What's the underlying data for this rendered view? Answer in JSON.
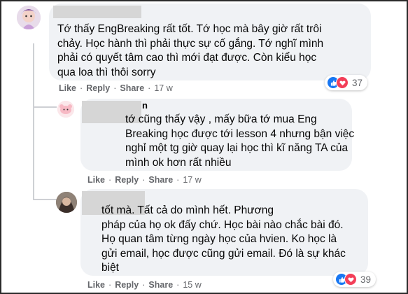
{
  "comments": [
    {
      "text": "Tớ thấy EngBreaking rất tốt. Tớ học mà bây giờ rất trôi\nchảy. Học hành thì phải thực sự cố gắng. Tớ nghĩ mình\nphải có quyết tâm cao thì mới đạt được. Còn kiểu học\nqua loa thì thôi sorry",
      "like_label": "Like",
      "reply_label": "Reply",
      "share_label": "Share",
      "time": "17 w",
      "reaction_count": "37",
      "reactions": [
        "like-icon",
        "love-icon"
      ]
    },
    {
      "name_fragment": "n",
      "text": "     tớ cũng thấy vậy , mấy bữa tớ mua Eng\nBreaking học được tới lesson 4 nhưng bận việc\nnghỉ một tg giờ quay lại học thì kĩ năng TA của\nmình ok hơn rất nhiều",
      "like_label": "Like",
      "reply_label": "Reply",
      "share_label": "Share",
      "time": "17 w"
    },
    {
      "text": "          tốt mà. Tất cả do mình hết. Phương\npháp của họ ok đấy chứ. Học bài nào chắc bài đó.\nHọ quan tâm từng ngày học của hvien. Ko học là\ngửi email, học được cũng gửi email. Đó là sự khác\nbiệt",
      "like_label": "Like",
      "reply_label": "Reply",
      "share_label": "Share",
      "time": "15 w",
      "reaction_count": "39",
      "reactions": [
        "like-icon",
        "love-icon"
      ]
    }
  ],
  "colors": {
    "bubble": "#f0f2f5",
    "meta": "#65676b",
    "like": "#1877f2",
    "love": "#f33e58",
    "redaction": "#d6d6d6"
  }
}
